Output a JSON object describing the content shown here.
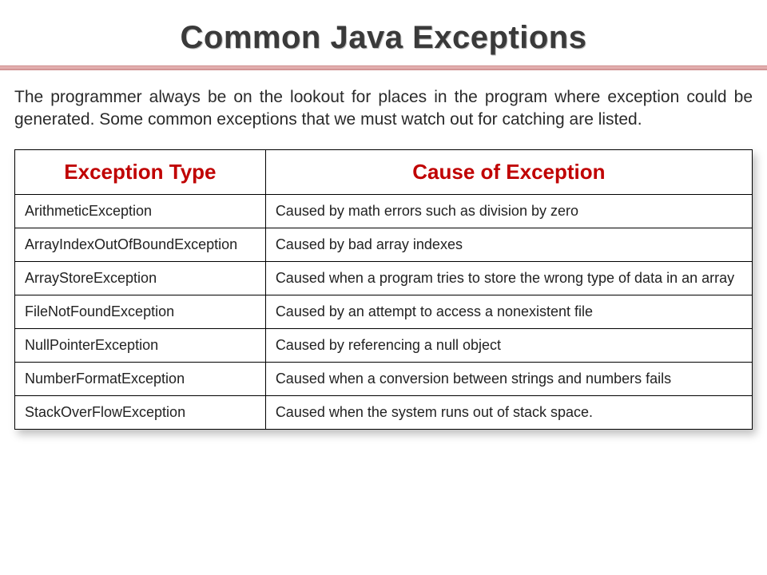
{
  "title": "Common Java Exceptions",
  "intro": "The programmer always be on the lookout for places in the program where exception could be generated. Some common exceptions that we must watch out for catching are listed.",
  "table": {
    "headers": {
      "type": "Exception Type",
      "cause": "Cause of Exception"
    },
    "rows": [
      {
        "type": "ArithmeticException",
        "cause": "Caused by math errors such as division by zero"
      },
      {
        "type": "ArrayIndexOutOfBoundException",
        "cause": "Caused by bad array indexes"
      },
      {
        "type": "ArrayStoreException",
        "cause": "Caused when a program tries to store the wrong type of data in an array"
      },
      {
        "type": "FileNotFoundException",
        "cause": "Caused by an attempt to access a nonexistent file"
      },
      {
        "type": "NullPointerException",
        "cause": "Caused by referencing a null object"
      },
      {
        "type": "NumberFormatException",
        "cause": "Caused when a conversion between strings and numbers fails"
      },
      {
        "type": "StackOverFlowException",
        "cause": "Caused when the system runs out of stack space."
      }
    ]
  }
}
